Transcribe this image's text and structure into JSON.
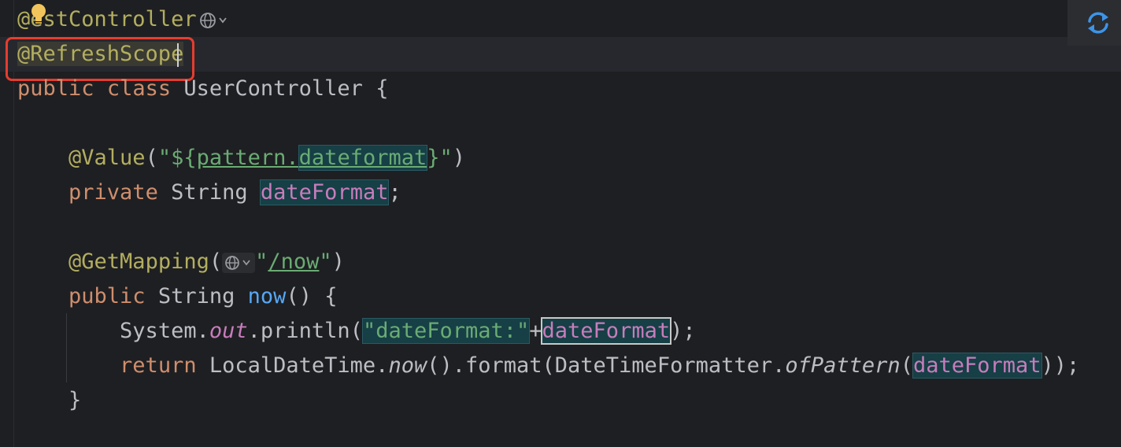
{
  "code": {
    "l1": {
      "at": "@",
      "rest": "estController"
    },
    "l2": {
      "text": "@RefreshScope"
    },
    "l3": {
      "kw_public": "public",
      "kw_class": "class",
      "name": "UserController",
      "brace": "{"
    },
    "l5": {
      "ann": "@Value",
      "paren_open": "(",
      "str_open": "\"${",
      "str_mid": "pattern.",
      "str_key": "dateformat",
      "str_close": "}\"",
      "paren_close": ")"
    },
    "l6": {
      "kw": "private",
      "type": "String",
      "field": "dateFormat",
      "semi": ";"
    },
    "l8": {
      "ann": "@GetMapping",
      "paren_open": "(",
      "str_q1": "\"",
      "str_path": "/now",
      "str_q2": "\"",
      "paren_close": ")"
    },
    "l9": {
      "kw": "public",
      "type": "String",
      "method": "now",
      "rest": "() {"
    },
    "l10": {
      "sys": "System.",
      "out": "out",
      "println": ".println(",
      "str": "\"dateFormat:\"",
      "plus": "+",
      "field": "dateFormat",
      "end": ");"
    },
    "l11": {
      "kw": "return",
      "cls": "LocalDateTime.",
      "now": "now",
      "fmt": "().format(DateTimeFormatter.",
      "of": "ofPattern",
      "paren": "(",
      "field": "dateFormat",
      "end": "));"
    },
    "l12": {
      "brace": "}"
    }
  },
  "icons": {
    "bulb": "lightbulb-icon",
    "globe": "globe-icon",
    "refresh": "refresh-icon"
  },
  "colors": {
    "background": "#1e1f22",
    "annotation": "#b3ae60",
    "keyword": "#cf8e6d",
    "string": "#6aab73",
    "field": "#c77dbb",
    "method": "#56a8f5",
    "highlight_box": "#e53d2f",
    "refresh_accent": "#3d94e8"
  }
}
